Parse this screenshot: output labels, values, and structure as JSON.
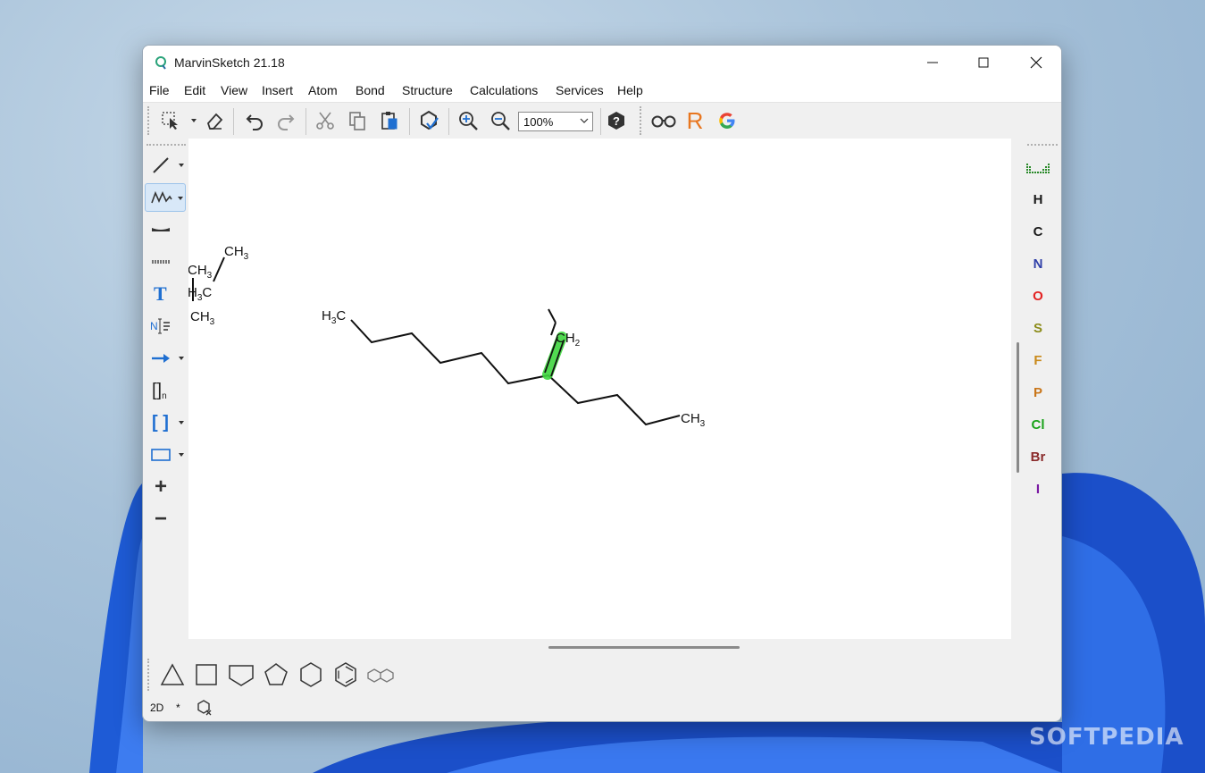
{
  "window": {
    "title": "MarvinSketch 21.18"
  },
  "menu": [
    "File",
    "Edit",
    "View",
    "Insert",
    "Atom",
    "Bond",
    "Structure",
    "Calculations",
    "Services",
    "Help"
  ],
  "toolbar": {
    "zoom_value": "100%",
    "reaction_label": "R",
    "google_label": "G"
  },
  "left_tools": {
    "text_tool_label": "T",
    "n_label": "N",
    "bracket_n_label": "[]",
    "bracket_n_sub": "n",
    "bracket_label": "[ ]",
    "plus_label": "+",
    "minus_label": "−"
  },
  "atoms": [
    {
      "symbol": "H",
      "color": "#1a1a1a"
    },
    {
      "symbol": "C",
      "color": "#1a1a1a"
    },
    {
      "symbol": "N",
      "color": "#2f3fa8"
    },
    {
      "symbol": "O",
      "color": "#e32222"
    },
    {
      "symbol": "S",
      "color": "#8c8c1a"
    },
    {
      "symbol": "F",
      "color": "#c98a1a"
    },
    {
      "symbol": "P",
      "color": "#c9761a"
    },
    {
      "symbol": "Cl",
      "color": "#1aa31a"
    },
    {
      "symbol": "Br",
      "color": "#8a2a2a"
    },
    {
      "symbol": "I",
      "color": "#7a1aa3"
    }
  ],
  "molecule_labels": {
    "small_ch3_top": "CH",
    "small_ch3_mid": "CH",
    "small_h3c": "H",
    "small_h3c_c": "C",
    "small_ch3_bottom": "CH",
    "sub3": "3",
    "sub2": "2",
    "main_h3c": "H",
    "main_h3c_c": "C",
    "main_ch2": "CH",
    "main_ch3": "CH"
  },
  "status": {
    "dimension": "2D",
    "modified": "*"
  },
  "watermark": "SOFTPEDIA"
}
